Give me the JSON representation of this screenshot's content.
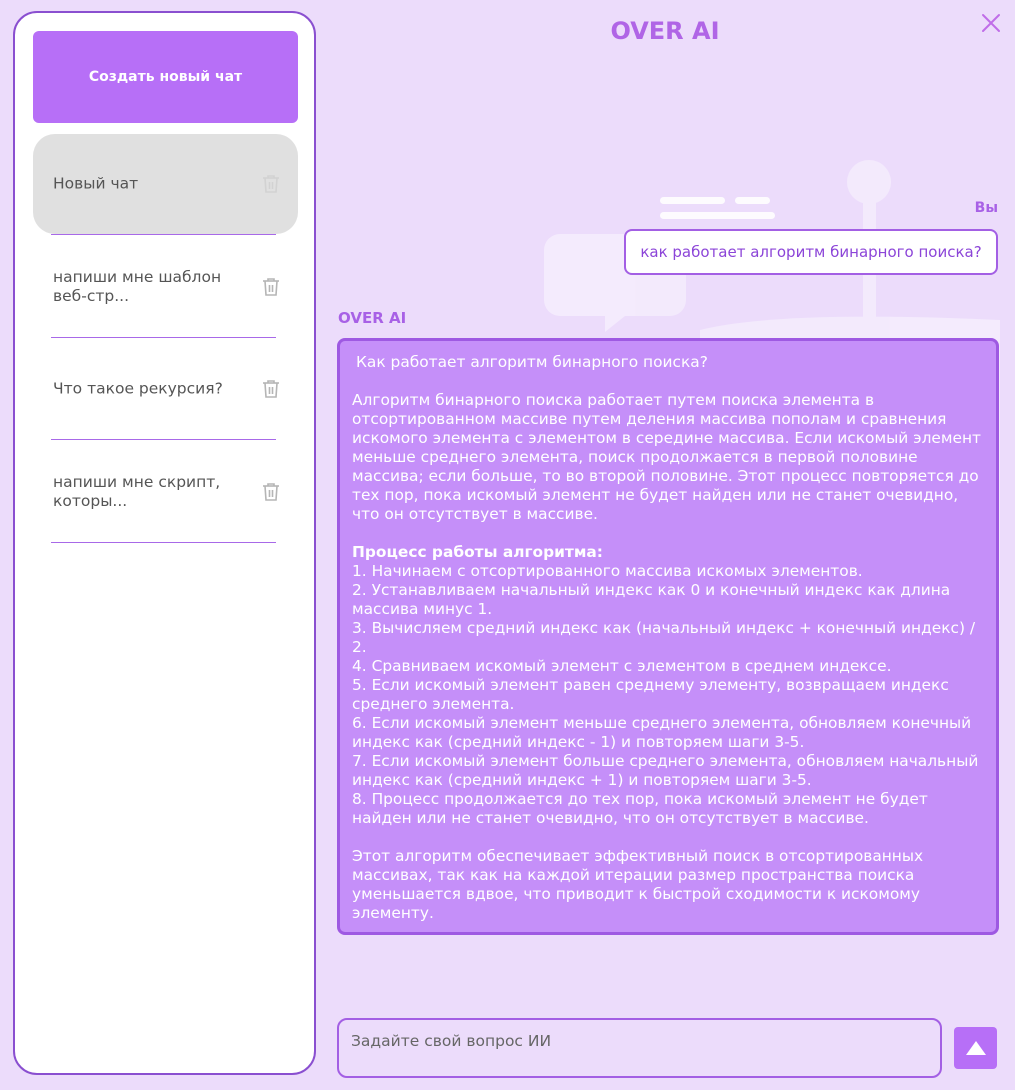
{
  "app": {
    "title": "OVER AI"
  },
  "sidebar": {
    "new_chat_label": "Создать новый чат",
    "chats": [
      {
        "label": "Новый чат",
        "active": true
      },
      {
        "label": "напиши мне шаблон веб-стр...",
        "active": false
      },
      {
        "label": "Что такое рекурсия?",
        "active": false
      },
      {
        "label": "напиши мне скрипт, которы...",
        "active": false
      }
    ]
  },
  "conversation": {
    "user_label": "Вы",
    "user_message": "как работает алгоритм бинарного поиска?",
    "ai_label": "OVER AI",
    "ai_message": {
      "heading": "Как работает алгоритм бинарного поиска?",
      "intro": "Алгоритм бинарного поиска работает путем поиска элемента в отсортированном массиве путем деления массива пополам и сравнения искомого элемента с элементом в середине массива. Если искомый элемент меньше среднего элемента, поиск продолжается в первой половине массива; если больше, то во второй половине. Этот процесс повторяется до тех пор, пока искомый элемент не будет найден или не станет очевидно, что он отсутствует в массиве.",
      "steps_title": "Процесс работы алгоритма:",
      "steps": [
        "1. Начинаем с отсортированного массива искомых элементов.",
        "2. Устанавливаем начальный индекс как 0 и конечный индекс как длина массива минус 1.",
        "3. Вычисляем средний индекс как (начальный индекс + конечный индекс) / 2.",
        "4. Сравниваем искомый элемент с элементом в среднем индексе.",
        "5. Если искомый элемент равен среднему элементу, возвращаем индекс среднего элемента.",
        "6. Если искомый элемент меньше среднего элемента, обновляем конечный индекс как (средний индекс - 1) и повторяем шаги 3-5.",
        "7. Если искомый элемент больше среднего элемента, обновляем начальный индекс как (средний индекс + 1) и повторяем шаги 3-5.",
        "8. Процесс продолжается до тех пор, пока искомый элемент не будет найден или не станет очевидно, что он отсутствует в массиве."
      ],
      "conclusion": "Этот алгоритм обеспечивает эффективный поиск в отсортированных массивах, так как на каждой итерации размер пространства поиска уменьшается вдвое, что приводит к быстрой сходимости к искомому элементу."
    }
  },
  "composer": {
    "placeholder": "Задайте свой вопрос ИИ"
  },
  "colors": {
    "background": "#ecdcfb",
    "accent": "#b76ff7",
    "accent_border": "#a35fe4",
    "ai_bubble": "#c58ff9"
  },
  "icons": {
    "close": "close-icon",
    "trash": "trash-icon",
    "send": "arrow-up-icon"
  }
}
